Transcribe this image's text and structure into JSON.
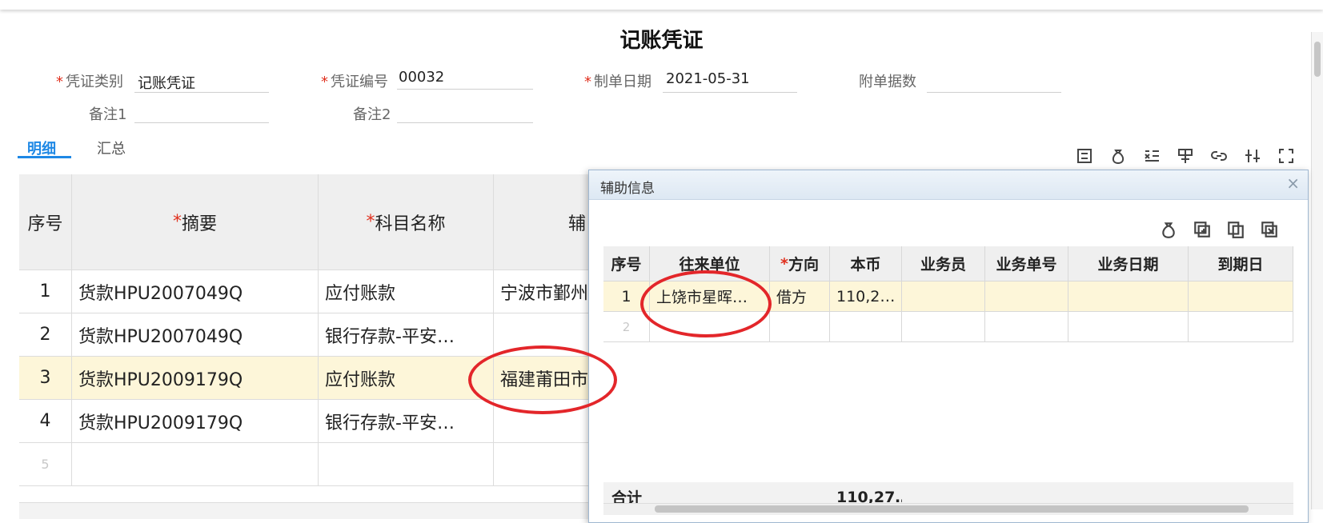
{
  "title": "记账凭证",
  "fields": {
    "voucher_type_label": "凭证类别",
    "voucher_type_value": "记账凭证",
    "voucher_no_label": "凭证编号",
    "voucher_no_value": "00032",
    "date_label": "制单日期",
    "date_value": "2021-05-31",
    "attach_label": "附单据数",
    "attach_value": "",
    "remark1_label": "备注1",
    "remark1_value": "",
    "remark2_label": "备注2",
    "remark2_value": "",
    "required_mark": "*"
  },
  "tabs": {
    "detail": "明细",
    "summary": "汇总"
  },
  "toolbar_icons": [
    "align-icon",
    "money-bag-icon",
    "list-edit-icon",
    "merge-icon",
    "link-icon",
    "adjust-icon",
    "fullscreen-icon"
  ],
  "grid": {
    "headers": {
      "seq": "序号",
      "summary": "摘要",
      "account": "科目名称",
      "aux": "辅"
    },
    "rows": [
      {
        "seq": "1",
        "summary": "货款HPU2007049Q",
        "account": "应付账款",
        "aux": "宁波市鄞州"
      },
      {
        "seq": "2",
        "summary": "货款HPU2007049Q",
        "account": "银行存款-平安…",
        "aux": ""
      },
      {
        "seq": "3",
        "summary": "货款HPU2009179Q",
        "account": "应付账款",
        "aux": "福建莆田市"
      },
      {
        "seq": "4",
        "summary": "货款HPU2009179Q",
        "account": "银行存款-平安…",
        "aux": ""
      },
      {
        "seq": "5",
        "summary": "",
        "account": "",
        "aux": ""
      }
    ],
    "selected_row": 3
  },
  "popup": {
    "title": "辅助信息",
    "close": "×",
    "icons": [
      "money-bag-icon",
      "add-row-icon",
      "copy-icon",
      "delete-icon"
    ],
    "headers": [
      "序号",
      "往来单位",
      "方向",
      "本币",
      "业务员",
      "业务单号",
      "业务日期",
      "到期日"
    ],
    "rows": [
      {
        "seq": "1",
        "unit": "上饶市星晖…",
        "dir": "借方",
        "amount": "110,2…",
        "staff": "",
        "biz_no": "",
        "biz_date": "",
        "due": ""
      },
      {
        "seq": "2",
        "unit": "",
        "dir": "",
        "amount": "",
        "staff": "",
        "biz_no": "",
        "biz_date": "",
        "due": ""
      }
    ],
    "total_label": "合计",
    "total_amount": "110,27…"
  },
  "colors": {
    "accent": "#1e88e5",
    "required": "#e0301e",
    "selected_row": "#fdf6d9",
    "annotation": "#e3262a"
  }
}
